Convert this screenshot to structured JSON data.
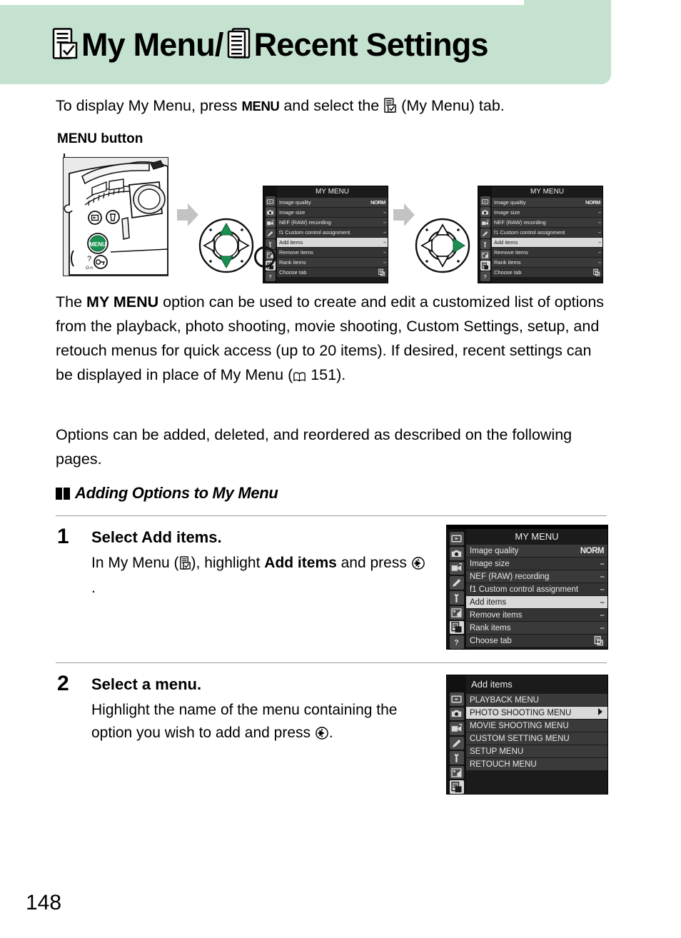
{
  "header": {
    "title_part1": "My Menu/",
    "title_part2": "Recent Settings",
    "icon1": "my-menu-icon",
    "icon2": "recent-settings-icon",
    "band_color": "#c4e2cf"
  },
  "intro": {
    "text_a": "To display My Menu, press ",
    "menu_key": "MENU",
    "text_b": " and select the ",
    "text_c": " (My Menu) tab.",
    "menu_button_caption": "MENU button"
  },
  "illustration": {
    "camera_label": "camera-back-illustration",
    "menu_button_color": "#1a9050",
    "arrow_color": "#bcbcbc",
    "selector1_highlight": "up-down",
    "selector2_highlight": "right"
  },
  "lcd_my_menu": {
    "title": "MY MENU",
    "rows": [
      {
        "label": "Image quality",
        "value": "NORM",
        "highlight": false
      },
      {
        "label": "Image size",
        "value": "--",
        "highlight": false
      },
      {
        "label": "NEF (RAW) recording",
        "value": "--",
        "highlight": false
      },
      {
        "label": "f1 Custom control assignment",
        "value": "--",
        "highlight": false
      },
      {
        "label": "Add items",
        "value": "--",
        "highlight": true
      },
      {
        "label": "Remove items",
        "value": "--",
        "highlight": false
      },
      {
        "label": "Rank items",
        "value": "--",
        "highlight": false
      },
      {
        "label": "Choose tab",
        "value": "icon",
        "highlight": false
      }
    ],
    "rail_icons": [
      "playback-icon",
      "photo-shooting-icon",
      "movie-shooting-icon",
      "custom-settings-icon",
      "setup-icon",
      "retouch-icon",
      "my-menu-icon",
      "help-icon"
    ],
    "selected_rail_index": 6
  },
  "lcd_add_items": {
    "title": "Add items",
    "rows": [
      {
        "label": "PLAYBACK MENU",
        "highlight": false
      },
      {
        "label": "PHOTO SHOOTING MENU",
        "highlight": true
      },
      {
        "label": "MOVIE SHOOTING MENU",
        "highlight": false
      },
      {
        "label": "CUSTOM SETTING MENU",
        "highlight": false
      },
      {
        "label": "SETUP MENU",
        "highlight": false
      },
      {
        "label": "RETOUCH MENU",
        "highlight": false
      }
    ],
    "rail_icons": [
      "playback-icon",
      "photo-shooting-icon",
      "movie-shooting-icon",
      "custom-settings-icon",
      "setup-icon",
      "retouch-icon",
      "my-menu-icon"
    ],
    "selected_rail_index": 6
  },
  "body": {
    "para1_a": "The ",
    "para1_bold": "MY MENU",
    "para1_b": " option can be used to create and edit a customized list of options from the playback, photo shooting, movie shooting, Custom Settings, setup, and retouch menus for quick access (up to 20 items).  If desired, recent settings can be displayed in place of My Menu (",
    "para1_ref": "151",
    "para1_c": ").",
    "para2": "Options can be added, deleted, and reordered as described on the following pages."
  },
  "section": {
    "heading": "Adding Options to My Menu"
  },
  "steps": [
    {
      "number": "1",
      "title_a": "Select ",
      "title_bold": "Add items",
      "title_b": ".",
      "body_a": "In My Menu (",
      "body_b": "), highlight ",
      "body_bold": "Add items",
      "body_c": " and press ",
      "body_d": "."
    },
    {
      "number": "2",
      "title": "Select a menu.",
      "body_a": "Highlight the name of the menu containing the option you wish to add and press ",
      "body_d": "."
    }
  ],
  "footer": {
    "page_number": "148"
  }
}
